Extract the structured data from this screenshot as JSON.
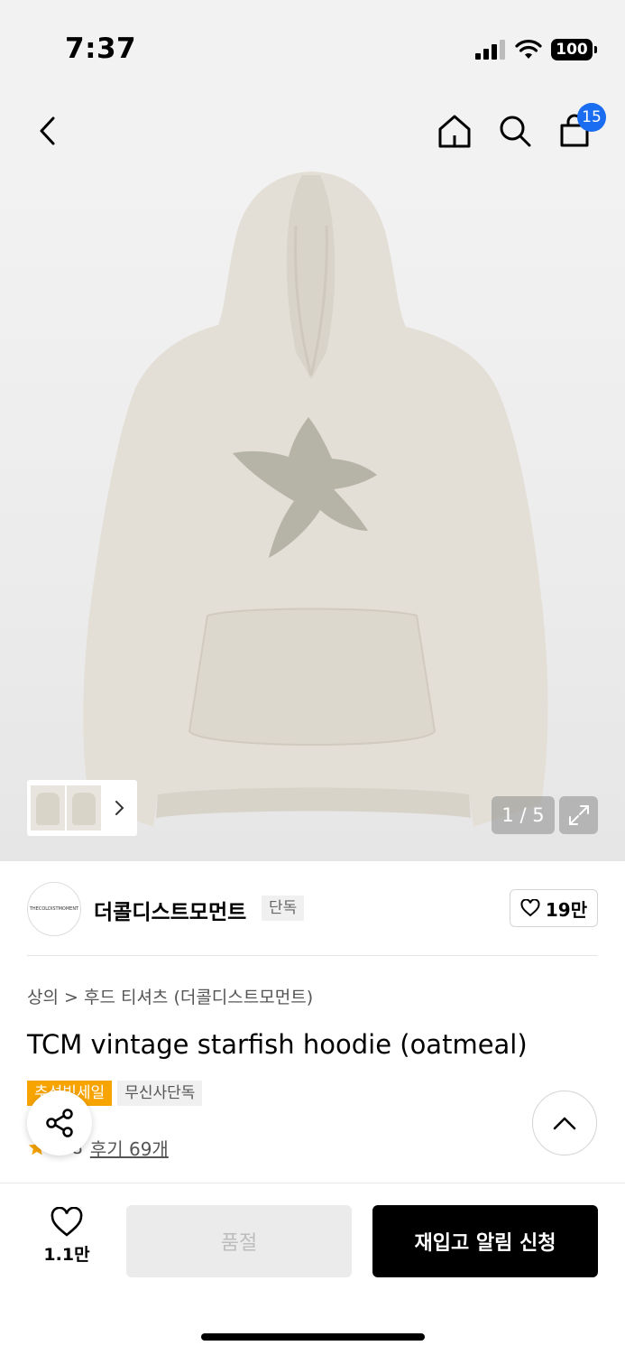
{
  "status_bar": {
    "time": "7:37",
    "battery": "100"
  },
  "nav": {
    "cart_count": "15"
  },
  "gallery": {
    "counter": "1 / 5"
  },
  "brand": {
    "logo_text": "THECOLDISTMOMENT",
    "name": "더콜디스트모먼트",
    "tag": "단독",
    "likes": "19만"
  },
  "product": {
    "breadcrumb": "상의 > 후드 티셔츠 (더콜디스트모먼트)",
    "title": "TCM vintage starfish hoodie (oatmeal)",
    "tags": [
      "추석빅세일",
      "무신사단독"
    ],
    "rating": "4.8",
    "reviews": "후기 69개"
  },
  "bottom": {
    "wish_count": "1.1만",
    "soldout_label": "품절",
    "restock_label": "재입고 알림 신청"
  },
  "colors": {
    "accent_blue": "#1a6cf0",
    "sale_orange": "#f7a400",
    "star": "#f7a400"
  }
}
